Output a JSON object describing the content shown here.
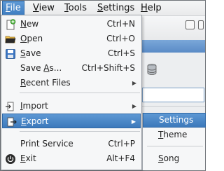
{
  "menubar": {
    "items": [
      {
        "label": "File",
        "mnemonic": "F",
        "rest": "ile"
      },
      {
        "label": "View",
        "mnemonic": "V",
        "rest": "iew"
      },
      {
        "label": "Tools",
        "mnemonic": "T",
        "rest": "ools"
      },
      {
        "label": "Settings",
        "mnemonic": "S",
        "rest": "ettings"
      },
      {
        "label": "Help",
        "mnemonic": "H",
        "rest": "elp"
      }
    ]
  },
  "file_menu": {
    "items": [
      {
        "mnemonic": "N",
        "rest": "ew",
        "shortcut": "Ctrl+N",
        "icon": "new-document-icon"
      },
      {
        "mnemonic": "O",
        "rest": "pen",
        "shortcut": "Ctrl+O",
        "icon": "open-folder-icon"
      },
      {
        "mnemonic": "S",
        "rest": "ave",
        "shortcut": "Ctrl+S",
        "icon": "save-disk-icon"
      },
      {
        "pre": "Save ",
        "mnemonic": "A",
        "rest": "s...",
        "shortcut": "Ctrl+Shift+S"
      },
      {
        "mnemonic": "R",
        "rest": "ecent Files",
        "arrow": "▶"
      },
      {
        "mnemonic": "I",
        "rest": "mport",
        "arrow": "▶",
        "icon": "import-icon"
      },
      {
        "mnemonic": "E",
        "rest": "xport",
        "arrow": "▶",
        "icon": "export-icon"
      },
      {
        "pre": "Print Service",
        "shortcut": "Ctrl+P"
      },
      {
        "mnemonic": "E",
        "rest": "xit",
        "shortcut": "Alt+F4",
        "icon": "power-icon"
      }
    ]
  },
  "export_submenu": {
    "items": [
      {
        "label": "Settings"
      },
      {
        "mnemonic": "T",
        "rest": "heme"
      },
      {
        "mnemonic": "S",
        "rest": "ong"
      }
    ]
  },
  "colors": {
    "highlight": "#3c79bb",
    "menu_bg": "#f6f7f8"
  }
}
